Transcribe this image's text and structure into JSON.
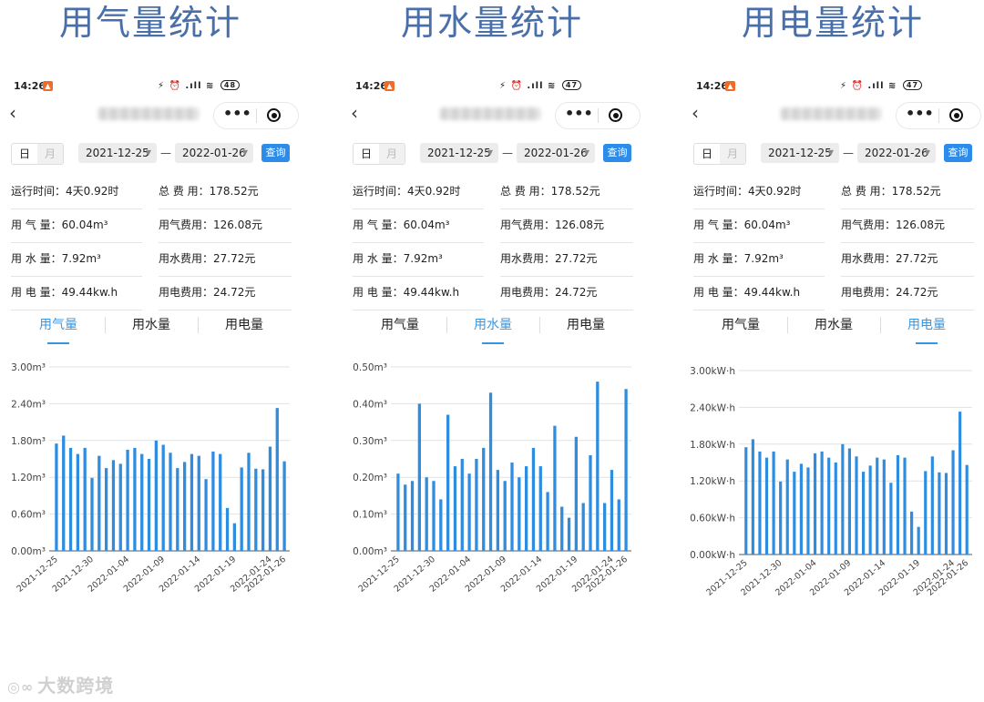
{
  "colors": {
    "accent": "#3597e3",
    "bar": "#2f8de0",
    "title": "#4a6fa8",
    "query": "#2d8cea"
  },
  "statusbar": {
    "time": "14:26",
    "sys_icons": "⚡ ⏰ .ıll ≋",
    "batteries": [
      "48",
      "47",
      "47"
    ]
  },
  "filter": {
    "day_label": "日",
    "month_label": "月",
    "start_date": "2021-12-25",
    "end_date": "2022-01-26",
    "dash": "—",
    "query_label": "查询"
  },
  "stats": {
    "run_time_label": "运行时间：",
    "run_time": "4天0.92时",
    "total_fee_label": "总 费 用：",
    "total_fee": "178.52元",
    "gas_label": "用 气 量：",
    "gas": "60.04m³",
    "gas_fee_label": "用气费用：",
    "gas_fee": "126.08元",
    "water_label": "用 水 量：",
    "water": "7.92m³",
    "water_fee_label": "用水费用：",
    "water_fee": "27.72元",
    "power_label": "用 电 量：",
    "power": "49.44kw.h",
    "power_fee_label": "用电费用：",
    "power_fee": "24.72元"
  },
  "tabs": [
    "用气量",
    "用水量",
    "用电量"
  ],
  "panels": [
    {
      "title": "用气量统计",
      "active_tab": 0
    },
    {
      "title": "用水量统计",
      "active_tab": 1
    },
    {
      "title": "用电量统计",
      "active_tab": 2
    }
  ],
  "watermark": {
    "icon": "◎∞",
    "text": "大数跨境"
  },
  "chart_data": [
    {
      "type": "bar",
      "x_ticks": [
        "2021-12-25",
        "2021-12-30",
        "2022-01-04",
        "2022-01-09",
        "2022-01-14",
        "2022-01-19",
        "2022-01-24",
        "2022-01-26"
      ],
      "y_ticks": [
        "0.00m³",
        "0.60m³",
        "1.20m³",
        "1.80m³",
        "2.40m³",
        "3.00m³"
      ],
      "ylim": [
        0,
        3.0
      ],
      "categories": [
        "2021-12-25",
        "2021-12-26",
        "2021-12-27",
        "2021-12-28",
        "2021-12-29",
        "2021-12-30",
        "2021-12-31",
        "2022-01-01",
        "2022-01-02",
        "2022-01-03",
        "2022-01-04",
        "2022-01-05",
        "2022-01-06",
        "2022-01-07",
        "2022-01-08",
        "2022-01-09",
        "2022-01-10",
        "2022-01-11",
        "2022-01-12",
        "2022-01-13",
        "2022-01-14",
        "2022-01-15",
        "2022-01-16",
        "2022-01-17",
        "2022-01-18",
        "2022-01-19",
        "2022-01-20",
        "2022-01-21",
        "2022-01-22",
        "2022-01-23",
        "2022-01-24",
        "2022-01-25",
        "2022-01-26"
      ],
      "values": [
        1.75,
        1.88,
        1.68,
        1.58,
        1.68,
        1.19,
        1.55,
        1.35,
        1.48,
        1.42,
        1.65,
        1.68,
        1.58,
        1.5,
        1.8,
        1.73,
        1.6,
        1.35,
        1.45,
        1.58,
        1.55,
        1.17,
        1.62,
        1.58,
        0.7,
        0.45,
        1.36,
        1.6,
        1.34,
        1.33,
        1.7,
        2.33,
        1.46
      ],
      "grid": true
    },
    {
      "type": "bar",
      "x_ticks": [
        "2021-12-25",
        "2021-12-30",
        "2022-01-04",
        "2022-01-09",
        "2022-01-14",
        "2022-01-19",
        "2022-01-24",
        "2022-01-26"
      ],
      "y_ticks": [
        "0.00m³",
        "0.10m³",
        "0.20m³",
        "0.30m³",
        "0.40m³",
        "0.50m³"
      ],
      "ylim": [
        0,
        0.5
      ],
      "categories": [
        "2021-12-25",
        "2021-12-26",
        "2021-12-27",
        "2021-12-28",
        "2021-12-29",
        "2021-12-30",
        "2021-12-31",
        "2022-01-01",
        "2022-01-02",
        "2022-01-03",
        "2022-01-04",
        "2022-01-05",
        "2022-01-06",
        "2022-01-07",
        "2022-01-08",
        "2022-01-09",
        "2022-01-10",
        "2022-01-11",
        "2022-01-12",
        "2022-01-13",
        "2022-01-14",
        "2022-01-15",
        "2022-01-16",
        "2022-01-17",
        "2022-01-18",
        "2022-01-19",
        "2022-01-20",
        "2022-01-21",
        "2022-01-22",
        "2022-01-23",
        "2022-01-24",
        "2022-01-25",
        "2022-01-26"
      ],
      "values": [
        0.21,
        0.18,
        0.19,
        0.4,
        0.2,
        0.19,
        0.14,
        0.37,
        0.23,
        0.25,
        0.21,
        0.25,
        0.28,
        0.43,
        0.22,
        0.19,
        0.24,
        0.2,
        0.23,
        0.28,
        0.23,
        0.16,
        0.34,
        0.12,
        0.09,
        0.31,
        0.13,
        0.26,
        0.46,
        0.13,
        0.22,
        0.14,
        0.44
      ],
      "grid": true
    },
    {
      "type": "bar",
      "x_ticks": [
        "2021-12-25",
        "2021-12-30",
        "2022-01-04",
        "2022-01-09",
        "2022-01-14",
        "2022-01-19",
        "2022-01-24",
        "2022-01-26"
      ],
      "y_ticks": [
        "0.00kW·h",
        "0.60kW·h",
        "1.20kW·h",
        "1.80kW·h",
        "2.40kW·h",
        "3.00kW·h"
      ],
      "ylim": [
        0,
        3.0
      ],
      "categories": [
        "2021-12-25",
        "2021-12-26",
        "2021-12-27",
        "2021-12-28",
        "2021-12-29",
        "2021-12-30",
        "2021-12-31",
        "2022-01-01",
        "2022-01-02",
        "2022-01-03",
        "2022-01-04",
        "2022-01-05",
        "2022-01-06",
        "2022-01-07",
        "2022-01-08",
        "2022-01-09",
        "2022-01-10",
        "2022-01-11",
        "2022-01-12",
        "2022-01-13",
        "2022-01-14",
        "2022-01-15",
        "2022-01-16",
        "2022-01-17",
        "2022-01-18",
        "2022-01-19",
        "2022-01-20",
        "2022-01-21",
        "2022-01-22",
        "2022-01-23",
        "2022-01-24",
        "2022-01-25",
        "2022-01-26"
      ],
      "values": [
        1.75,
        1.88,
        1.68,
        1.58,
        1.68,
        1.19,
        1.55,
        1.35,
        1.48,
        1.42,
        1.65,
        1.68,
        1.58,
        1.5,
        1.8,
        1.73,
        1.6,
        1.35,
        1.45,
        1.58,
        1.55,
        1.17,
        1.62,
        1.58,
        0.7,
        0.45,
        1.36,
        1.6,
        1.34,
        1.33,
        1.7,
        2.33,
        1.46
      ],
      "grid": true
    }
  ]
}
